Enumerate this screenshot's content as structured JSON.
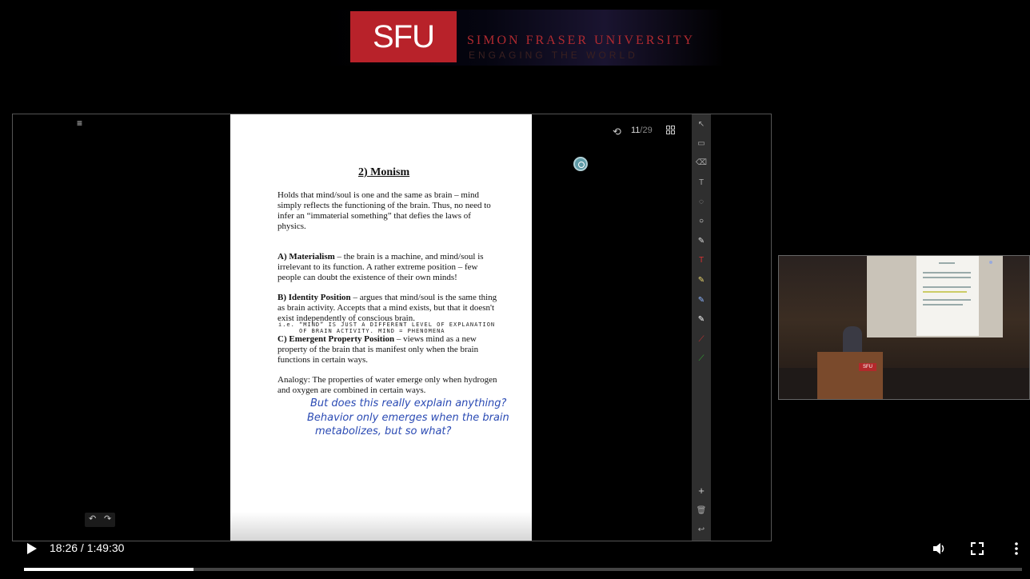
{
  "banner": {
    "logo_text": "SFU",
    "university_name": "SIMON FRASER UNIVERSITY",
    "tagline": "ENGAGING THE WORLD",
    "brand_color": "#b8222a"
  },
  "document": {
    "title": "2) Monism",
    "paragraphs": [
      {
        "bold": "",
        "text": "Holds that mind/soul is one and the same as brain – mind simply reflects the functioning of the brain. Thus, no need to infer an “immaterial something” that defies the laws of physics."
      },
      {
        "bold": "A) Materialism",
        "text": " – the brain is a machine, and mind/soul is irrelevant to its function. A rather extreme position – few people can doubt the existence of their own minds!"
      },
      {
        "bold": "B) Identity Position",
        "text": " – argues that mind/soul is the same thing as brain activity. Accepts that a mind exists, but that it doesn't exist independently of conscious brain."
      },
      {
        "bold": "C) Emergent Property Position",
        "text": " – views mind as a new property of the brain that is manifest only when the brain functions in certain ways."
      },
      {
        "bold": "",
        "text": "Analogy: The properties of water emerge only when hydrogen and oxygen are combined in certain ways."
      }
    ],
    "annotation_small_1": "i.e. “MIND” IS JUST A DIFFERENT LEVEL OF EXPLANATION",
    "annotation_small_2": "OF BRAIN ACTIVITY. MIND = PHENOMENA",
    "handwritten_1": "But does this really explain anything?",
    "handwritten_2": "Behavior only emerges when the brain",
    "handwritten_3": "metabolizes, but so what?"
  },
  "viewer": {
    "current_page": "11",
    "separator": "/",
    "total_pages": "29",
    "history_icon": "history-icon",
    "grid_icon": "grid-view-icon",
    "menu_icon": "hamburger-menu-icon",
    "undo_icon": "undo-icon",
    "redo_icon": "redo-icon"
  },
  "toolbar": {
    "tools": [
      "pointer-tool-icon",
      "folder-icon",
      "eraser-icon",
      "text-size-icon",
      "lasso-icon",
      "circle-shape-icon",
      "pen-icon",
      "text-tool-icon",
      "highlighter-icon",
      "blue-pen-icon",
      "white-pen-icon",
      "red-line-icon",
      "green-line-icon"
    ],
    "bottom_tools": [
      "add-icon",
      "trash-icon",
      "undo-arrow-icon"
    ]
  },
  "player": {
    "current_time": "18:26",
    "duration": "1:49:30",
    "progress_fraction": 0.17,
    "play_icon": "play-icon",
    "volume_icon": "volume-icon",
    "fullscreen_icon": "fullscreen-icon",
    "more_icon": "more-options-icon"
  },
  "pip": {
    "podium_logo": "SFU",
    "doc_title": "2) Monism"
  }
}
